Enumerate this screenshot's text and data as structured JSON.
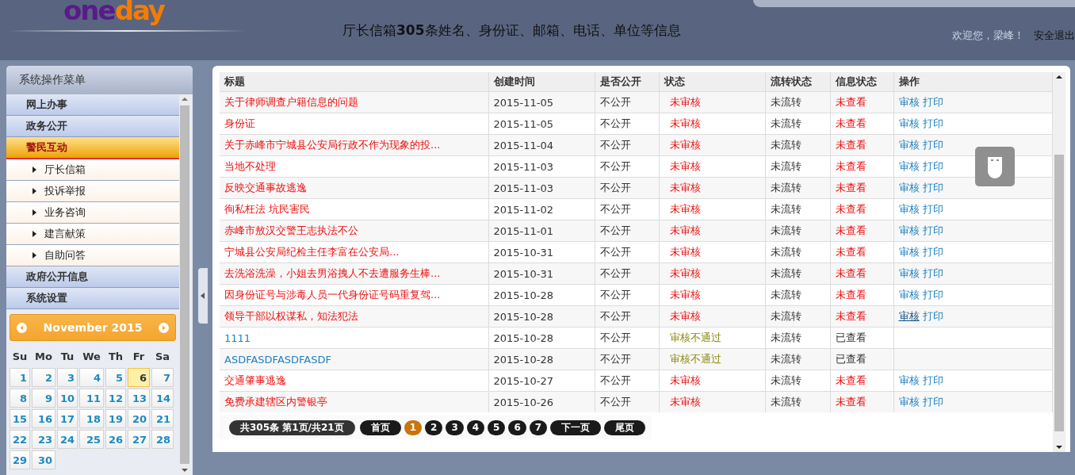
{
  "header": {
    "logo_left": "one",
    "logo_right": "day",
    "headline": "厅长信箱**305**条姓名、身份证、邮箱、电话、单位等信息",
    "welcome": "欢迎您，梁峰！",
    "logout": "安全退出"
  },
  "sidebar": {
    "title": "系统操作菜单",
    "items": [
      {
        "label": "网上办事",
        "selected": false
      },
      {
        "label": "政务公开",
        "selected": false
      },
      {
        "label": "警民互动",
        "selected": true,
        "children": [
          {
            "label": "厅长信箱"
          },
          {
            "label": "投诉举报"
          },
          {
            "label": "业务咨询"
          },
          {
            "label": "建言献策"
          },
          {
            "label": "自助问答"
          }
        ]
      },
      {
        "label": "政府公开信息",
        "selected": false
      },
      {
        "label": "系统设置",
        "selected": false
      }
    ]
  },
  "calendar": {
    "month": "November 2015",
    "weekdays": [
      "Su",
      "Mo",
      "Tu",
      "We",
      "Th",
      "Fr",
      "Sa"
    ],
    "days": [
      {
        "label": "1",
        "selected": false
      },
      {
        "label": "2",
        "selected": false
      },
      {
        "label": "3",
        "selected": false
      },
      {
        "label": "4",
        "selected": false
      },
      {
        "label": "5",
        "selected": false
      },
      {
        "label": "6",
        "selected": true
      },
      {
        "label": "7",
        "selected": false
      },
      {
        "label": "8",
        "selected": false
      },
      {
        "label": "9",
        "selected": false
      },
      {
        "label": "10",
        "selected": false
      },
      {
        "label": "11",
        "selected": false
      },
      {
        "label": "12",
        "selected": false
      },
      {
        "label": "13",
        "selected": false
      },
      {
        "label": "14",
        "selected": false
      },
      {
        "label": "15",
        "selected": false
      },
      {
        "label": "16",
        "selected": false
      },
      {
        "label": "17",
        "selected": false
      },
      {
        "label": "18",
        "selected": false
      },
      {
        "label": "19",
        "selected": false
      },
      {
        "label": "20",
        "selected": false
      },
      {
        "label": "21",
        "selected": false
      },
      {
        "label": "22",
        "selected": false
      },
      {
        "label": "23",
        "selected": false
      },
      {
        "label": "24",
        "selected": false
      },
      {
        "label": "25",
        "selected": false
      },
      {
        "label": "26",
        "selected": false
      },
      {
        "label": "27",
        "selected": false
      },
      {
        "label": "28",
        "selected": false
      },
      {
        "label": "29",
        "selected": false
      },
      {
        "label": "30",
        "selected": false
      }
    ]
  },
  "table": {
    "columns": [
      "标题",
      "创建时间",
      "是否公开",
      "状态",
      "流转状态",
      "信息状态",
      "操作"
    ],
    "rows": [
      {
        "kind": "pending",
        "title": "关于律师调查户籍信息的问题",
        "date": "2015-11-05",
        "public": "不公开",
        "status": "未审核",
        "flow": "未流转",
        "info": "未查看",
        "actions": [
          {
            "label": "审核",
            "hovered": false
          },
          {
            "label": "打印",
            "hovered": false
          }
        ]
      },
      {
        "kind": "pending",
        "title": "身份证",
        "date": "2015-11-05",
        "public": "不公开",
        "status": "未审核",
        "flow": "未流转",
        "info": "未查看",
        "actions": [
          {
            "label": "审核",
            "hovered": false
          },
          {
            "label": "打印",
            "hovered": false
          }
        ]
      },
      {
        "kind": "pending",
        "title": "关于赤峰市宁城县公安局行政不作为现象的投...",
        "date": "2015-11-04",
        "public": "不公开",
        "status": "未审核",
        "flow": "未流转",
        "info": "未查看",
        "actions": [
          {
            "label": "审核",
            "hovered": false
          },
          {
            "label": "打印",
            "hovered": false
          }
        ]
      },
      {
        "kind": "pending",
        "title": "当地不处理",
        "date": "2015-11-03",
        "public": "不公开",
        "status": "未审核",
        "flow": "未流转",
        "info": "未查看",
        "actions": [
          {
            "label": "审核",
            "hovered": false
          },
          {
            "label": "打印",
            "hovered": false
          }
        ]
      },
      {
        "kind": "pending",
        "title": "反映交通事故逃逸",
        "date": "2015-11-03",
        "public": "不公开",
        "status": "未审核",
        "flow": "未流转",
        "info": "未查看",
        "actions": [
          {
            "label": "审核",
            "hovered": false
          },
          {
            "label": "打印",
            "hovered": false
          }
        ]
      },
      {
        "kind": "pending",
        "title": "徇私枉法 坑民害民",
        "date": "2015-11-02",
        "public": "不公开",
        "status": "未审核",
        "flow": "未流转",
        "info": "未查看",
        "actions": [
          {
            "label": "审核",
            "hovered": false
          },
          {
            "label": "打印",
            "hovered": false
          }
        ]
      },
      {
        "kind": "pending",
        "title": "赤峰市敖汉交警王志执法不公",
        "date": "2015-11-01",
        "public": "不公开",
        "status": "未审核",
        "flow": "未流转",
        "info": "未查看",
        "actions": [
          {
            "label": "审核",
            "hovered": false
          },
          {
            "label": "打印",
            "hovered": false
          }
        ]
      },
      {
        "kind": "pending",
        "title": "宁城县公安局纪检主任李富在公安局...",
        "date": "2015-10-31",
        "public": "不公开",
        "status": "未审核",
        "flow": "未流转",
        "info": "未查看",
        "actions": [
          {
            "label": "审核",
            "hovered": false
          },
          {
            "label": "打印",
            "hovered": false
          }
        ]
      },
      {
        "kind": "pending",
        "title": "去洗浴洗澡，小姐去男浴拽人不去遭服务生棒...",
        "date": "2015-10-31",
        "public": "不公开",
        "status": "未审核",
        "flow": "未流转",
        "info": "未查看",
        "actions": [
          {
            "label": "审核",
            "hovered": false
          },
          {
            "label": "打印",
            "hovered": false
          }
        ]
      },
      {
        "kind": "pending",
        "title": "因身份证号与涉毒人员一代身份证号码重复驾...",
        "date": "2015-10-28",
        "public": "不公开",
        "status": "未审核",
        "flow": "未流转",
        "info": "未查看",
        "actions": [
          {
            "label": "审核",
            "hovered": false
          },
          {
            "label": "打印",
            "hovered": false
          }
        ]
      },
      {
        "kind": "pending",
        "title": "领导干部以权谋私，知法犯法",
        "date": "2015-10-28",
        "public": "不公开",
        "status": "未审核",
        "flow": "未流转",
        "info": "未查看",
        "actions": [
          {
            "label": "审核",
            "hovered": true
          },
          {
            "label": "打印",
            "hovered": false
          }
        ]
      },
      {
        "kind": "rejected",
        "title": "1111",
        "date": "2015-10-28",
        "public": "不公开",
        "status": "审核不通过",
        "flow": "未流转",
        "info": "已查看"
      },
      {
        "kind": "rejected",
        "title": "ASDFASDFASDFASDF",
        "date": "2015-10-28",
        "public": "不公开",
        "status": "审核不通过",
        "flow": "未流转",
        "info": "已查看"
      },
      {
        "kind": "pending",
        "title": "交通肇事逃逸",
        "date": "2015-10-27",
        "public": "不公开",
        "status": "未审核",
        "flow": "未流转",
        "info": "未查看",
        "actions": [
          {
            "label": "审核",
            "hovered": false
          },
          {
            "label": "打印",
            "hovered": false
          }
        ]
      },
      {
        "kind": "pending",
        "title": "免费承建辖区内警银亭",
        "date": "2015-10-26",
        "public": "不公开",
        "status": "未审核",
        "flow": "未流转",
        "info": "未查看",
        "actions": [
          {
            "label": "审核",
            "hovered": false
          },
          {
            "label": "打印",
            "hovered": false
          }
        ]
      }
    ]
  },
  "pagination": {
    "summary": "共305条 第1页/共21页",
    "pages": [
      {
        "label": "首页",
        "selected": false
      },
      {
        "label": "1",
        "selected": true
      },
      {
        "label": "2",
        "selected": false
      },
      {
        "label": "3",
        "selected": false
      },
      {
        "label": "4",
        "selected": false
      },
      {
        "label": "5",
        "selected": false
      },
      {
        "label": "6",
        "selected": false
      },
      {
        "label": "7",
        "selected": false
      },
      {
        "label": "下一页",
        "selected": false
      },
      {
        "label": "尾页",
        "selected": false
      }
    ]
  }
}
